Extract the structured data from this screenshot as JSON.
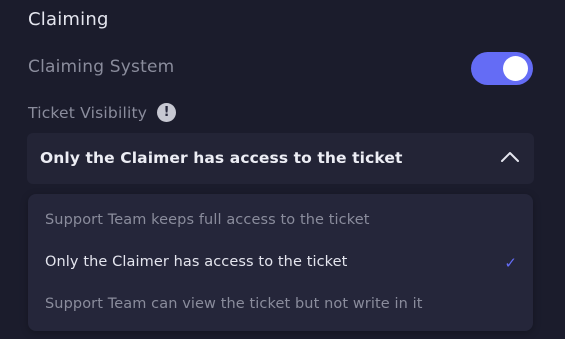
{
  "section": {
    "title": "Claiming"
  },
  "claiming_system": {
    "label": "Claiming System",
    "enabled": true,
    "accent_color": "#646cf5"
  },
  "ticket_visibility": {
    "label": "Ticket Visibility",
    "info_icon": "!",
    "selected": "Only the Claimer has access to the ticket",
    "options": [
      {
        "label": "Support Team keeps full access to the ticket",
        "selected": false
      },
      {
        "label": "Only the Claimer has access to the ticket",
        "selected": true,
        "check": "✓"
      },
      {
        "label": "Support Team can view the ticket but not write in it",
        "selected": false
      }
    ]
  }
}
